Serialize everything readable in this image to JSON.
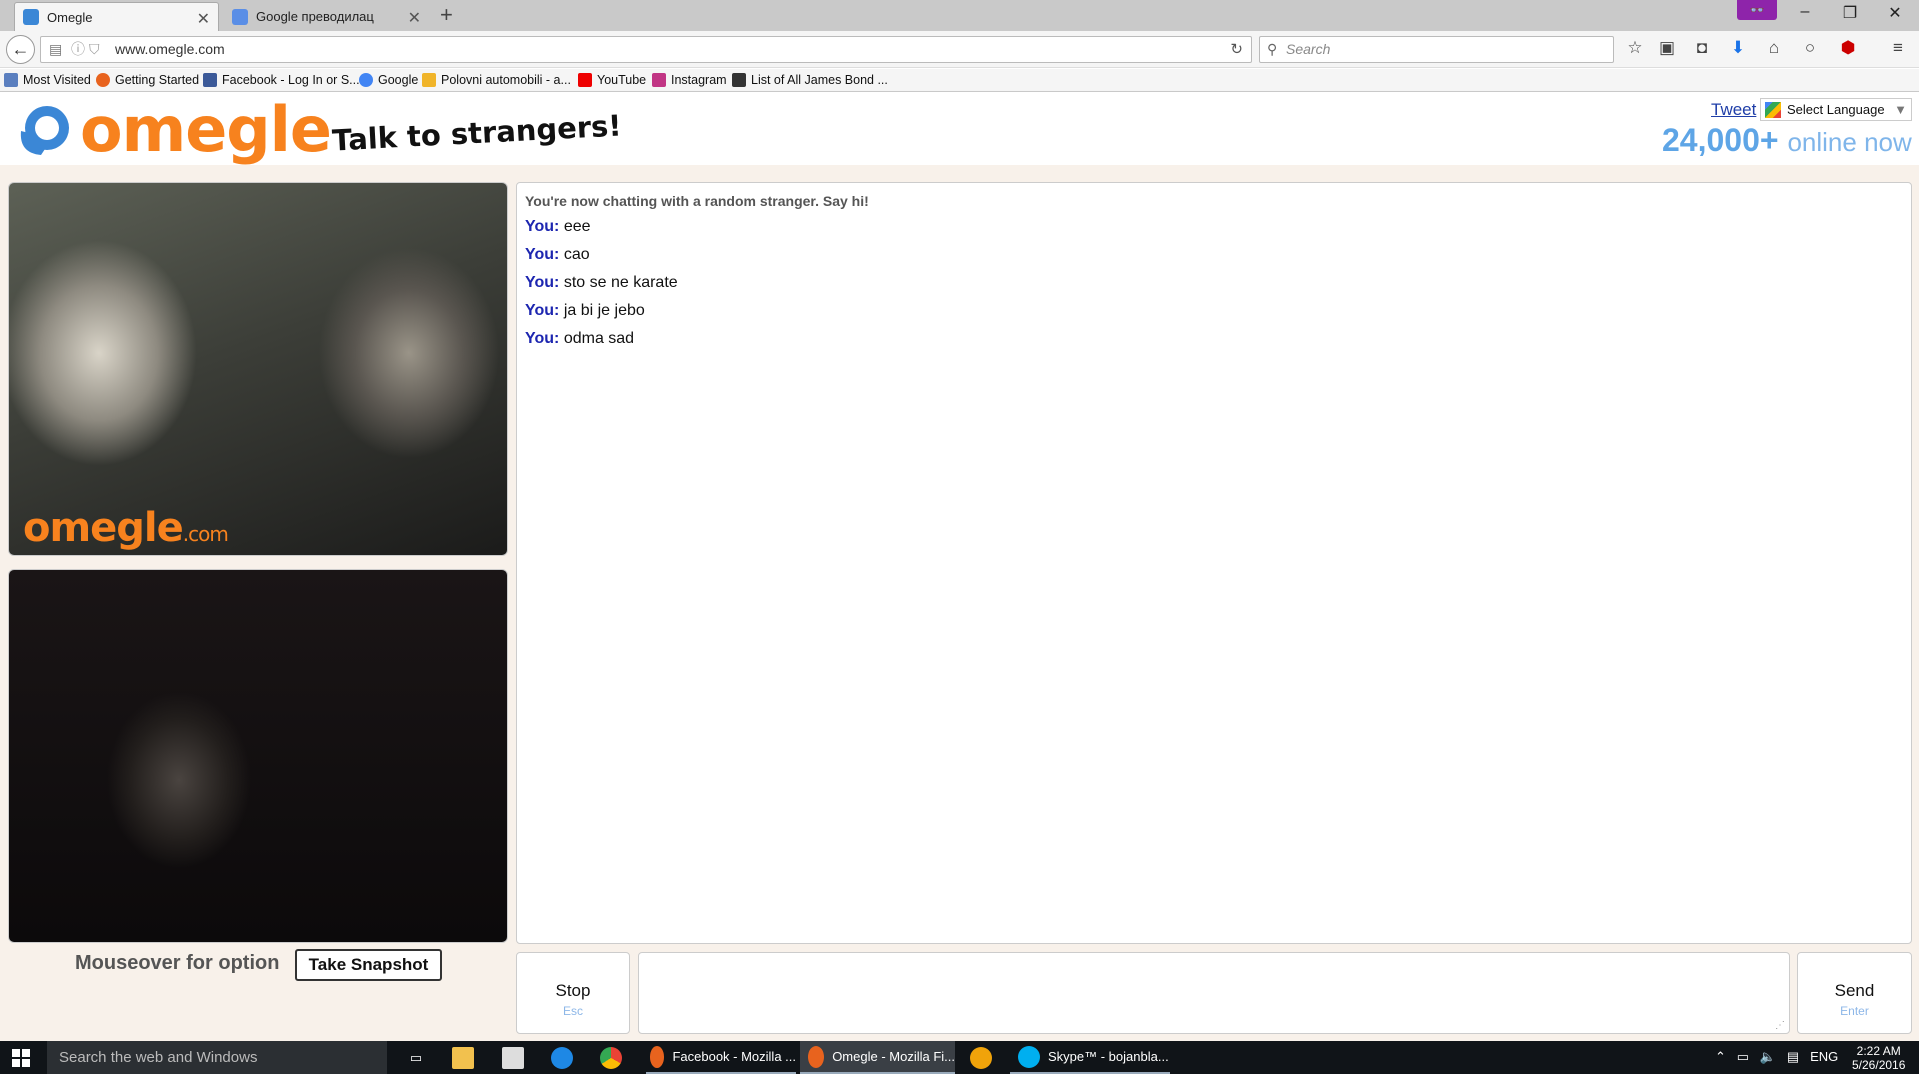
{
  "browser": {
    "tabs": [
      {
        "label": "Omegle",
        "active": true
      },
      {
        "label": "Google преводилац",
        "active": false
      }
    ],
    "url": "www.omegle.com",
    "search_placeholder": "Search",
    "bookmarks": [
      "Most Visited",
      "Getting Started",
      "Facebook - Log In or S...",
      "Google",
      "Polovni automobili - a...",
      "YouTube",
      "Instagram",
      "List of All James Bond ..."
    ]
  },
  "header": {
    "logo_text": "omegle",
    "tagline": "Talk to strangers!",
    "tweet_label": "Tweet",
    "language_label": "Select Language",
    "online_count": "24,000+",
    "online_label": "online now"
  },
  "video": {
    "watermark_main": "omegle",
    "watermark_suffix": ".com",
    "mouseover_label": "Mouseover for options",
    "snapshot_label": "Take Snapshot"
  },
  "chat": {
    "status": "You're now chatting with a random stranger. Say hi!",
    "messages": [
      {
        "who": "You:",
        "text": "eee"
      },
      {
        "who": "You:",
        "text": "cao"
      },
      {
        "who": "You:",
        "text": "sto se ne karate"
      },
      {
        "who": "You:",
        "text": "ja bi je jebo"
      },
      {
        "who": "You:",
        "text": "odma sad"
      }
    ],
    "stop_label": "Stop",
    "stop_key": "Esc",
    "send_label": "Send",
    "send_key": "Enter"
  },
  "taskbar": {
    "search_placeholder": "Search the web and Windows",
    "apps": [
      "Facebook - Mozilla ...",
      "Omegle - Mozilla Fi...",
      "Skype™ - bojanbla..."
    ],
    "language": "ENG",
    "time": "2:22 AM",
    "date": "5/26/2016"
  },
  "colors": {
    "omegle_orange": "#f7821e",
    "online_blue": "#5ea5e6",
    "you_blue": "#1d26b0"
  }
}
